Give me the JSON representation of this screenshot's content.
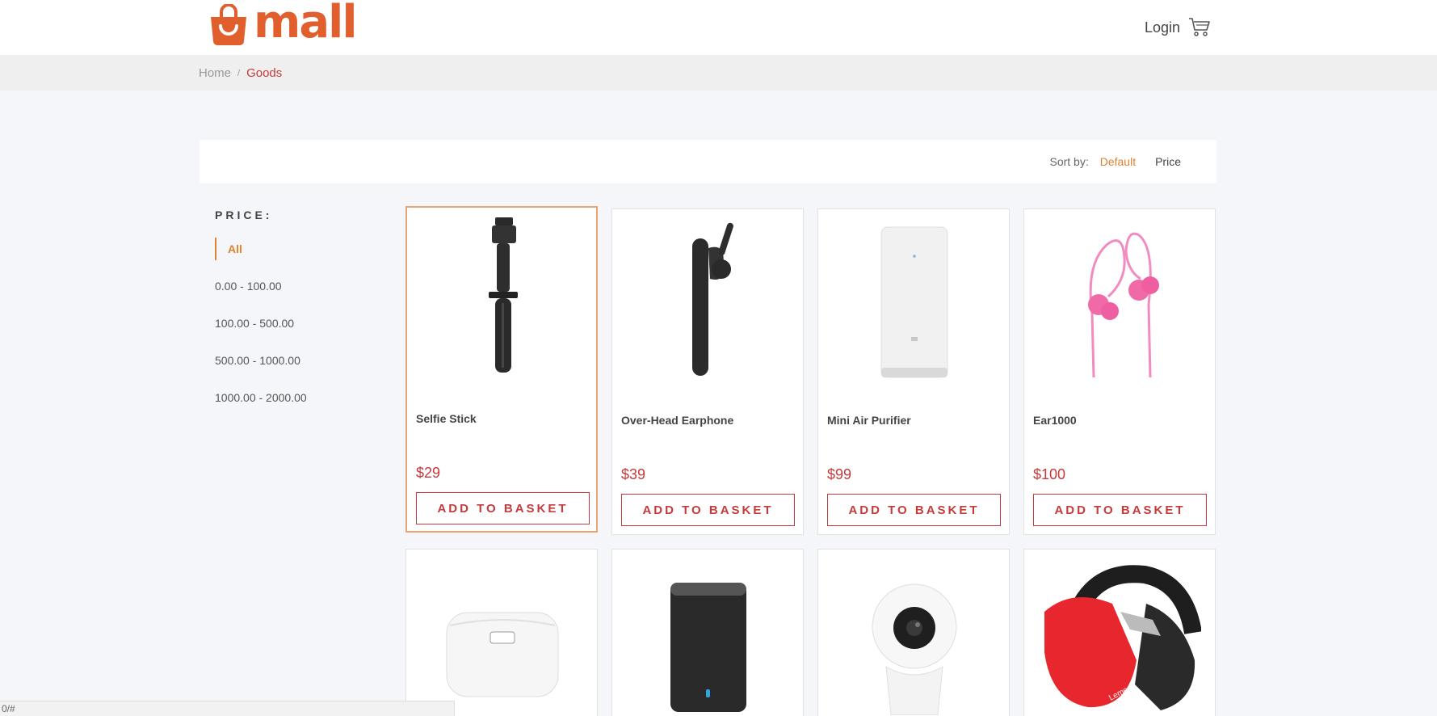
{
  "header": {
    "logo_text": "mall",
    "login_label": "Login"
  },
  "breadcrumb": {
    "home": "Home",
    "separator": "/",
    "current": "Goods"
  },
  "sort": {
    "label": "Sort by:",
    "default": "Default",
    "price": "Price"
  },
  "filter": {
    "heading": "PRICE:",
    "items": [
      "All",
      "0.00 - 100.00",
      "100.00 - 500.00",
      "500.00 - 1000.00",
      "1000.00 - 2000.00"
    ],
    "selected": "All"
  },
  "products": [
    {
      "name": "Selfie Stick",
      "price": "$29",
      "button": "ADD TO BASKET",
      "icon": "selfie-stick"
    },
    {
      "name": "Over-Head Earphone",
      "price": "$39",
      "button": "ADD TO BASKET",
      "icon": "bluetooth-earphone"
    },
    {
      "name": "Mini Air Purifier",
      "price": "$99",
      "button": "ADD TO BASKET",
      "icon": "air-purifier"
    },
    {
      "name": "Ear1000",
      "price": "$100",
      "button": "ADD TO BASKET",
      "icon": "pink-earphones"
    },
    {
      "name": "",
      "price": "",
      "button": "",
      "icon": "rice-cooker"
    },
    {
      "name": "",
      "price": "",
      "button": "",
      "icon": "cylinder-speaker"
    },
    {
      "name": "",
      "price": "",
      "button": "",
      "icon": "security-camera"
    },
    {
      "name": "",
      "price": "",
      "button": "",
      "icon": "red-headphones",
      "brand_text": "Leme"
    }
  ],
  "status_bar": {
    "url": "0/#"
  },
  "colors": {
    "brand": "#e05f2d",
    "accent": "#e0822d",
    "price": "#c53a3a"
  }
}
